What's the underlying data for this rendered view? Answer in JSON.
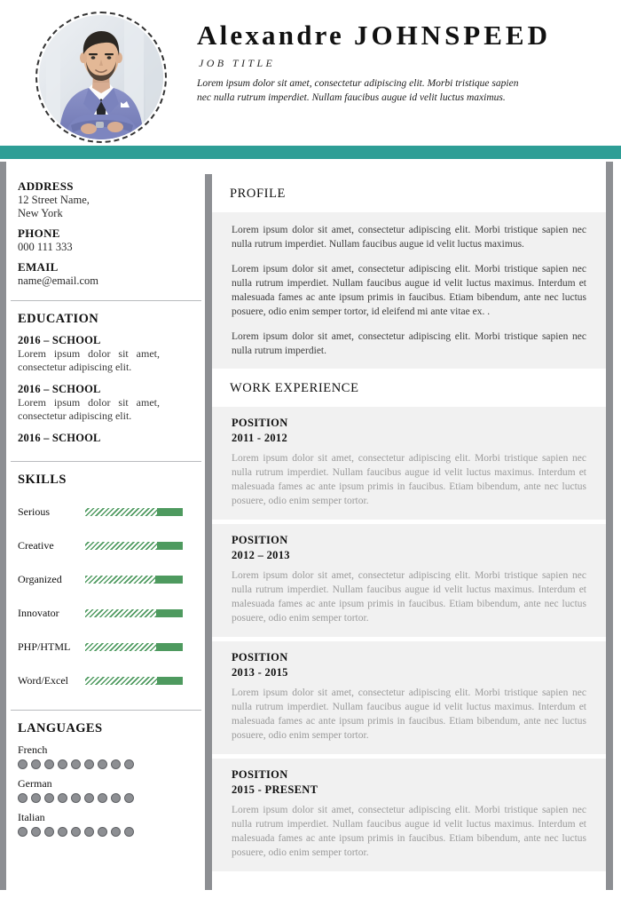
{
  "accent_color": "#2e9e96",
  "skill_bar_color": "#4e9a5f",
  "header": {
    "first_name": "Alexandre",
    "last_name": "JOHNSPEED",
    "job_title": "JOB TITLE",
    "tagline": "Lorem ipsum dolor sit amet, consectetur adipiscing elit. Morbi tristique sapien nec nulla rutrum imperdiet. Nullam faucibus augue id velit luctus maximus.",
    "photo_alt": "profile-photo"
  },
  "sidebar": {
    "contact": {
      "address_label": "ADDRESS",
      "address_line1": "12 Street Name,",
      "address_line2": "New York",
      "phone_label": "PHONE",
      "phone_value": "000 111 333",
      "email_label": "EMAIL",
      "email_value": "name@email.com"
    },
    "education": {
      "heading": "EDUCATION",
      "items": [
        {
          "title": "2016 – SCHOOL",
          "desc": "Lorem ipsum dolor sit amet, consectetur adipiscing elit."
        },
        {
          "title": "2016 – SCHOOL",
          "desc": "Lorem ipsum dolor sit amet, consectetur adipiscing elit."
        },
        {
          "title": "2016 – SCHOOL",
          "desc": ""
        }
      ]
    },
    "skills": {
      "heading": "SKILLS",
      "items": [
        {
          "label": "Serious",
          "hatch_pct": 74,
          "solid_pct": 26
        },
        {
          "label": "Creative",
          "hatch_pct": 74,
          "solid_pct": 26
        },
        {
          "label": "Organized",
          "hatch_pct": 72,
          "solid_pct": 28
        },
        {
          "label": "Innovator",
          "hatch_pct": 73,
          "solid_pct": 27
        },
        {
          "label": "PHP/HTML",
          "hatch_pct": 73,
          "solid_pct": 27
        },
        {
          "label": "Word/Excel",
          "hatch_pct": 74,
          "solid_pct": 26
        }
      ]
    },
    "languages": {
      "heading": "LANGUAGES",
      "items": [
        {
          "label": "French",
          "filled": 9,
          "total": 9
        },
        {
          "label": "German",
          "filled": 9,
          "total": 9
        },
        {
          "label": "Italian",
          "filled": 9,
          "total": 9
        }
      ]
    }
  },
  "main": {
    "profile": {
      "heading": "PROFILE",
      "paragraphs": [
        "Lorem ipsum dolor sit amet, consectetur adipiscing elit. Morbi tristique sapien nec nulla rutrum imperdiet. Nullam faucibus augue id velit luctus maximus.",
        "Lorem ipsum dolor sit amet, consectetur adipiscing elit. Morbi tristique sapien nec nulla rutrum imperdiet. Nullam faucibus augue id velit luctus maximus. Interdum et malesuada fames ac ante ipsum primis in faucibus. Etiam bibendum, ante nec luctus posuere, odio enim semper tortor, id eleifend mi ante vitae ex. .",
        "Lorem ipsum dolor sit amet, consectetur adipiscing elit. Morbi tristique sapien nec nulla rutrum imperdiet."
      ]
    },
    "work": {
      "heading": "WORK EXPERIENCE",
      "jobs": [
        {
          "position": "POSITION",
          "dates": "2011 - 2012",
          "desc": "Lorem ipsum dolor sit amet, consectetur adipiscing elit. Morbi tristique sapien nec nulla rutrum imperdiet. Nullam faucibus augue id velit luctus maximus. Interdum et malesuada fames ac ante ipsum primis in faucibus. Etiam bibendum, ante nec luctus posuere, odio enim semper tortor."
        },
        {
          "position": "POSITION",
          "dates": "2012 – 2013",
          "desc": "Lorem ipsum dolor sit amet, consectetur adipiscing elit. Morbi tristique sapien nec nulla rutrum imperdiet. Nullam faucibus augue id velit luctus maximus. Interdum et malesuada fames ac ante ipsum primis in faucibus. Etiam bibendum, ante nec luctus posuere, odio enim semper tortor."
        },
        {
          "position": "POSITION",
          "dates": "2013 - 2015",
          "desc": "Lorem ipsum dolor sit amet, consectetur adipiscing elit. Morbi tristique sapien nec nulla rutrum imperdiet. Nullam faucibus augue id velit luctus maximus. Interdum et malesuada fames ac ante ipsum primis in faucibus. Etiam bibendum, ante nec luctus posuere, odio enim semper tortor."
        },
        {
          "position": "POSITION",
          "dates": "2015 - PRESENT",
          "desc": "Lorem ipsum dolor sit amet, consectetur adipiscing elit. Morbi tristique sapien nec nulla rutrum imperdiet. Nullam faucibus augue id velit luctus maximus. Interdum et malesuada fames ac ante ipsum primis in faucibus. Etiam bibendum, ante nec luctus posuere, odio enim semper tortor."
        }
      ]
    }
  }
}
